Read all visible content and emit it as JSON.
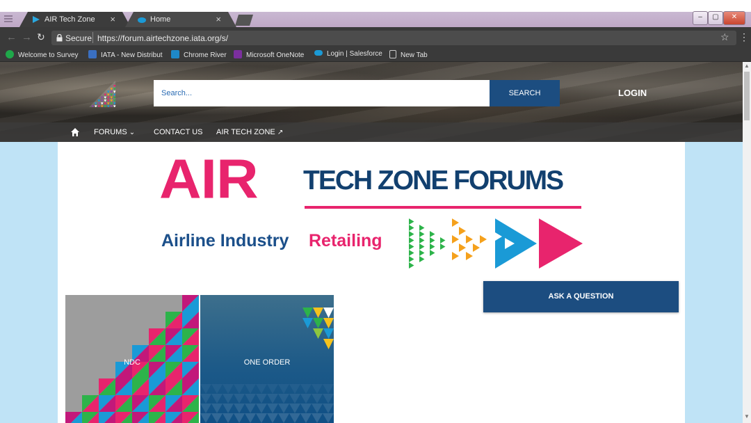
{
  "browser": {
    "tabs": [
      {
        "title": "AIR Tech Zone",
        "active": true
      },
      {
        "title": "Home",
        "active": false
      }
    ],
    "tab_close_glyph": "×",
    "secure_label": "Secure",
    "url": "https://forum.airtechzone.iata.org/s/",
    "bookmarks": [
      {
        "label": "Welcome to Survey",
        "icon": "survey-icon",
        "color": "#1fa84a"
      },
      {
        "label": "IATA - New Distribut",
        "icon": "iata-icon",
        "color": "#3a6fc1"
      },
      {
        "label": "Chrome River",
        "icon": "chrome-river-icon",
        "color": "#1e88c8"
      },
      {
        "label": "Microsoft OneNote",
        "icon": "onenote-icon",
        "color": "#7b2f9e"
      },
      {
        "label": "Login | Salesforce",
        "icon": "salesforce-icon",
        "color": "#1b9ad6"
      },
      {
        "label": "New Tab",
        "icon": "page-icon",
        "color": "#e5e5e5"
      }
    ]
  },
  "header": {
    "search_placeholder": "Search...",
    "search_button": "SEARCH",
    "login": "LOGIN"
  },
  "nav": {
    "items": [
      "FORUMS",
      "CONTACT US",
      "AIR TECH ZONE"
    ]
  },
  "banner": {
    "air": "AIR",
    "title": "TECH ZONE FORUMS",
    "tagline_part1": "Airline Industry",
    "tagline_part2": "Retailing"
  },
  "actions": {
    "ask": "ASK A QUESTION"
  },
  "tiles": [
    {
      "label": "NDC"
    },
    {
      "label": "ONE ORDER"
    }
  ],
  "colors": {
    "brand_pink": "#e8246d",
    "brand_navy": "#12406f",
    "button_blue": "#1c4d80",
    "page_bg": "#bfe3f6",
    "arrow_green": "#2db34a",
    "arrow_orange": "#f5a11c",
    "arrow_blue": "#1a9ad6"
  }
}
